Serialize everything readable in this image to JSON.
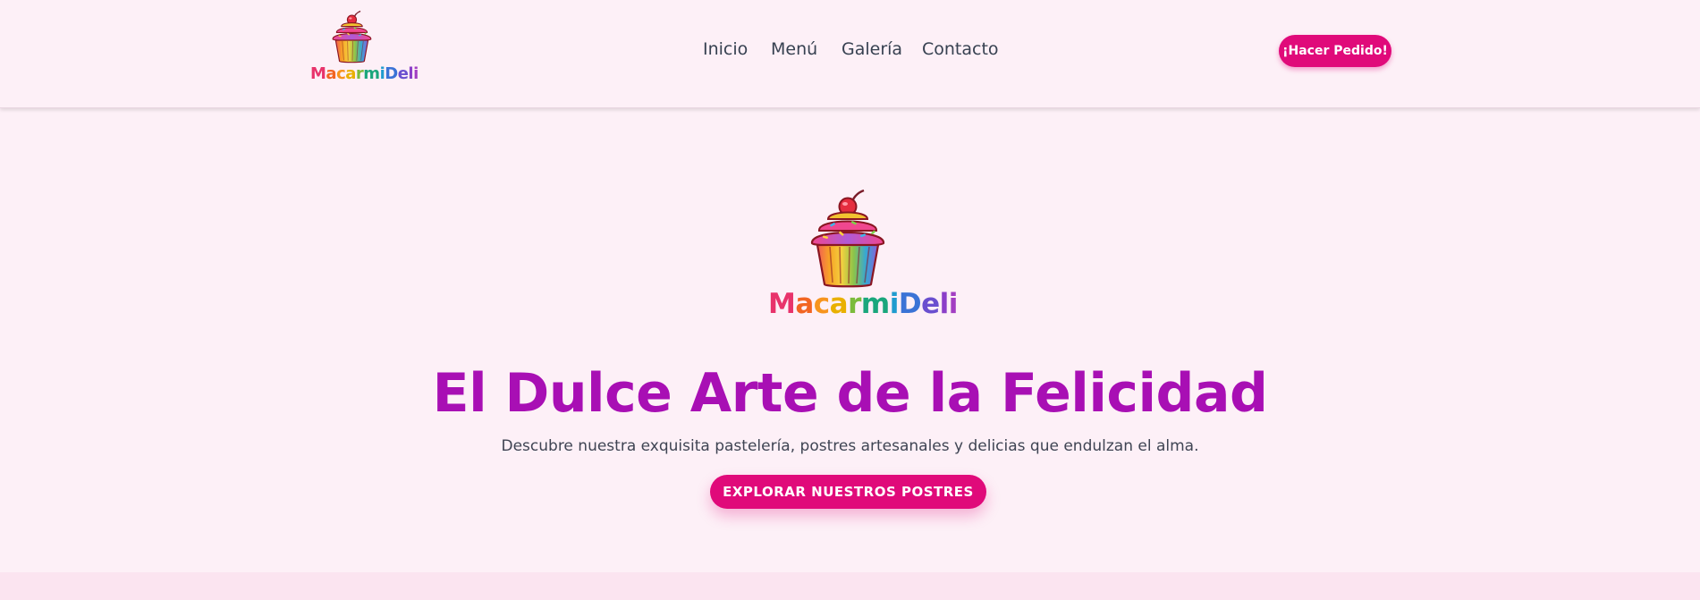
{
  "brand": {
    "name_parts": [
      "M",
      "a",
      "c",
      "a",
      "r",
      "m",
      "i",
      "D",
      "e",
      "l",
      "i"
    ],
    "letter_colors": [
      "#e8336b",
      "#f26522",
      "#f7941d",
      "#e9b000",
      "#7cbb3c",
      "#1aa67c",
      "#1f9bcf",
      "#3a73d6",
      "#6a4fcf",
      "#8b3fc9",
      "#a23ec2"
    ]
  },
  "nav": {
    "links": [
      "Inicio",
      "Menú",
      "Galería",
      "Contacto"
    ],
    "cta_label": "¡Hacer Pedido!"
  },
  "hero": {
    "title": "El Dulce Arte de la Felicidad",
    "subtitle": "Descubre nuestra exquisita pastelería, postres artesanales y delicias que endulzan el alma.",
    "cta_label": "EXPLORAR NUESTROS POSTRES"
  },
  "colors": {
    "accent": "#e00a7a",
    "title": "#a80fb4",
    "background": "#fdf0f7"
  },
  "icons": [
    "cupcake-logo-icon"
  ]
}
